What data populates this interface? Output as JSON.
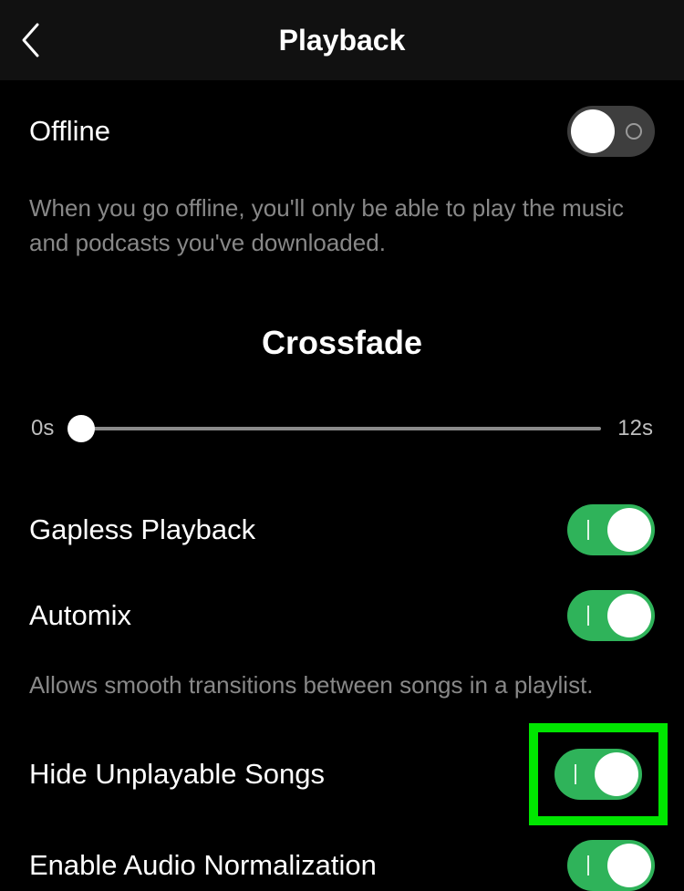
{
  "header": {
    "title": "Playback"
  },
  "offline": {
    "label": "Offline",
    "desc": "When you go offline, you'll only be able to play the music and podcasts you've downloaded.",
    "state": "off"
  },
  "crossfade": {
    "heading": "Crossfade",
    "min_label": "0s",
    "max_label": "12s"
  },
  "gapless": {
    "label": "Gapless Playback",
    "state": "on"
  },
  "automix": {
    "label": "Automix",
    "desc": "Allows smooth transitions between songs in a playlist.",
    "state": "on"
  },
  "hide_unplayable": {
    "label": "Hide Unplayable Songs",
    "state": "on"
  },
  "audio_norm": {
    "label": "Enable Audio Normalization",
    "state": "on"
  }
}
